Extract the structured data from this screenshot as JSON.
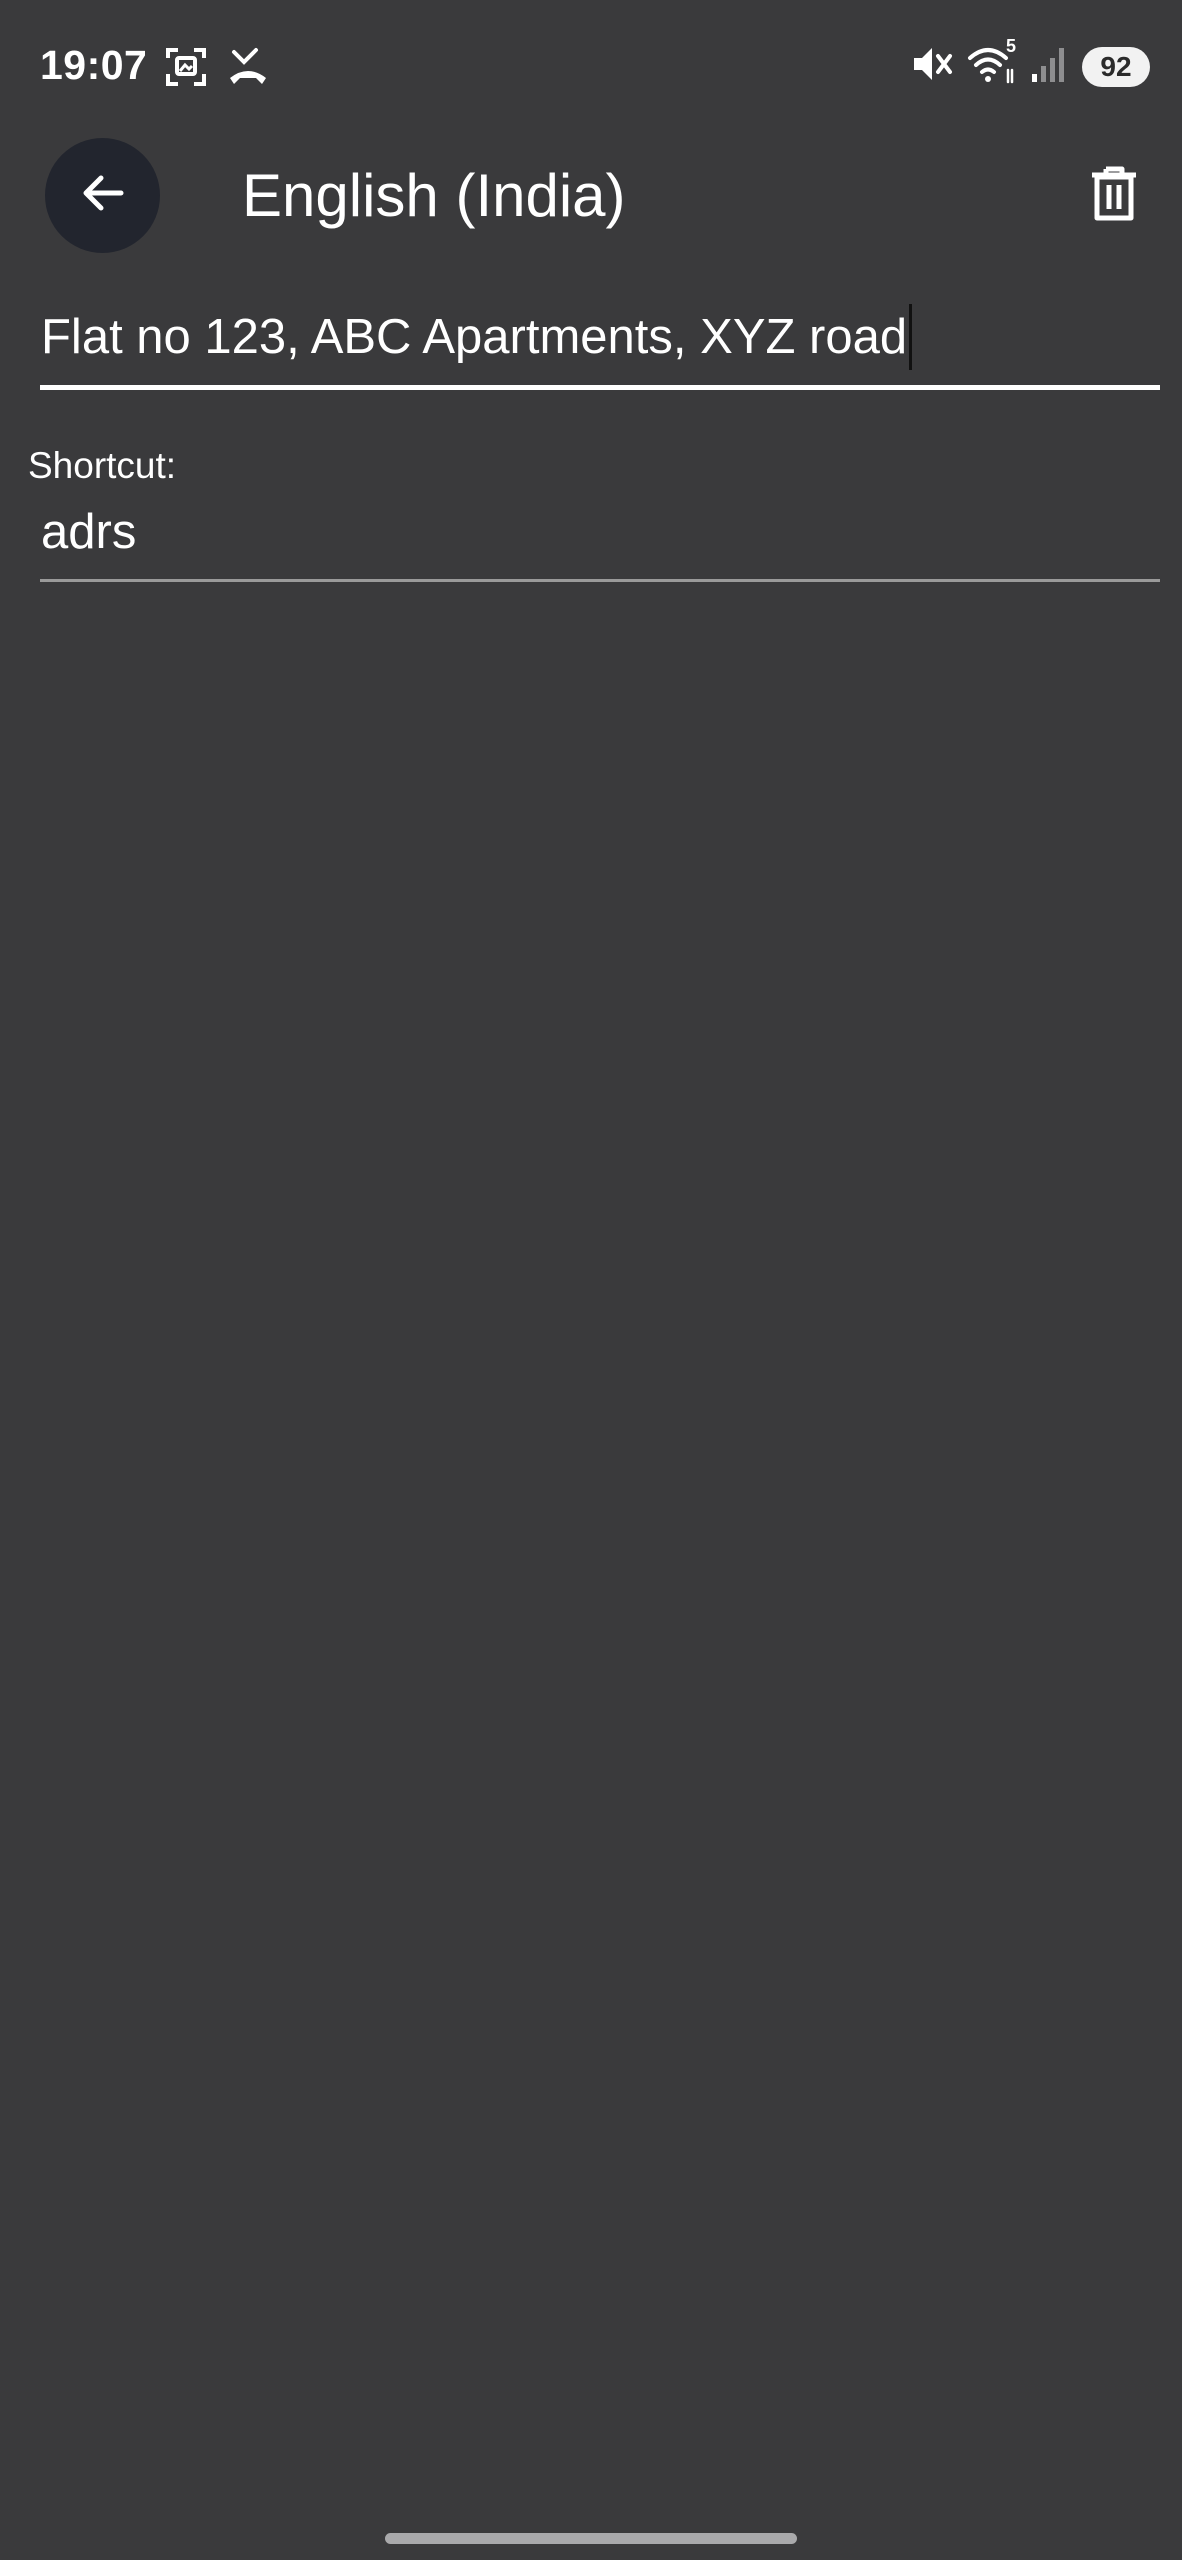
{
  "status_bar": {
    "time": "19:07",
    "battery": "92",
    "left_icons": [
      "screenshot-icon",
      "missed-call-icon"
    ],
    "right_icons": [
      "mute-icon",
      "wifi-icon",
      "signal-icon"
    ],
    "wifi_badge": "5"
  },
  "app_bar": {
    "title": "English (India)",
    "back_icon": "arrow-left-icon",
    "delete_icon": "trash-icon"
  },
  "phrase_input": {
    "value": "Flat no 123, ABC Apartments, XYZ road"
  },
  "shortcut": {
    "label": "Shortcut:",
    "value": "adrs"
  },
  "colors": {
    "background": "#3a3a3c",
    "back_button_bg": "#22252e",
    "text": "#ffffff",
    "underline_active": "#ffffff",
    "underline_inactive": "#9a9a9a"
  }
}
